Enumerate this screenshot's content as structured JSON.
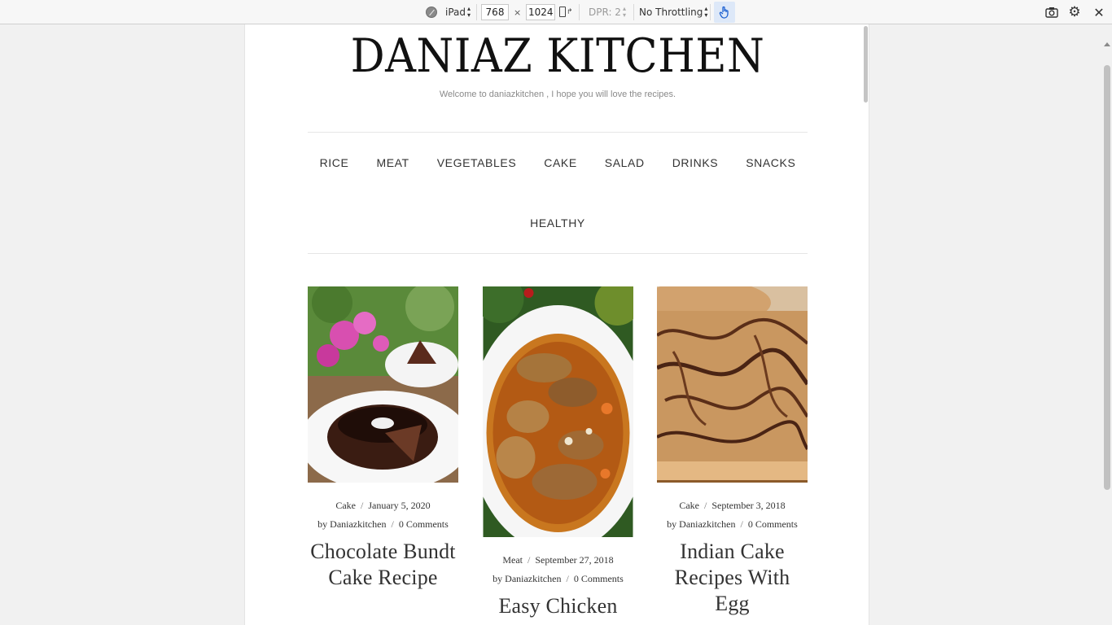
{
  "devtools": {
    "device": "iPad",
    "width": "768",
    "times": "×",
    "height": "1024",
    "dpr": "DPR: 2",
    "throttling": "No Throttling",
    "icons": {
      "device_mode": "disabled-circle-icon",
      "rotate": "rotate-device-icon",
      "touch": "touch-hand-icon",
      "screenshot": "camera-icon",
      "settings": "gear-icon",
      "close": "close-icon"
    }
  },
  "site": {
    "title": "DANIAZ KITCHEN",
    "description": "Welcome to daniazkitchen , I hope you will love the recipes."
  },
  "nav": {
    "row1": [
      "RICE",
      "MEAT",
      "VEGETABLES",
      "CAKE",
      "SALAD",
      "DRINKS",
      "SNACKS"
    ],
    "row2": [
      "HEALTHY"
    ]
  },
  "posts": [
    {
      "category": "Cake",
      "date": "January 5, 2020",
      "author": "by Daniazkitchen",
      "comments": "0 Comments",
      "title_lines": [
        "Chocolate Bundt",
        "Cake Recipe"
      ]
    },
    {
      "category": "Meat",
      "date": "September 27, 2018",
      "author": "by Daniazkitchen",
      "comments": "0 Comments",
      "title_lines": [
        "Easy Chicken"
      ]
    },
    {
      "category": "Cake",
      "date": "September 3, 2018",
      "author": "by Daniazkitchen",
      "comments": "0 Comments",
      "title_lines": [
        "Indian Cake",
        "Recipes With",
        "Egg"
      ]
    }
  ],
  "separator": "/"
}
